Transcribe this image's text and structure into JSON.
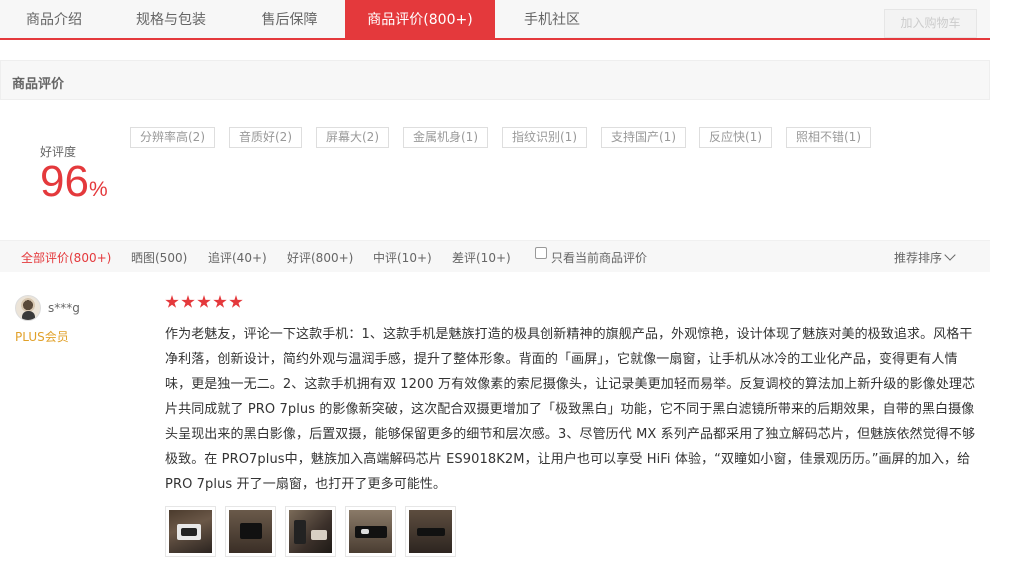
{
  "tabs": [
    {
      "label": "商品介绍"
    },
    {
      "label": "规格与包装"
    },
    {
      "label": "售后保障"
    },
    {
      "label": "商品评价(800+)",
      "active": true
    },
    {
      "label": "手机社区"
    }
  ],
  "cart_button": "加入购物车",
  "section_title": "商品评价",
  "rating": {
    "label": "好评度",
    "value": "96",
    "unit": "%"
  },
  "tags": [
    "分辨率高(2)",
    "音质好(2)",
    "屏幕大(2)",
    "金属机身(1)",
    "指纹识别(1)",
    "支持国产(1)",
    "反应快(1)",
    "照相不错(1)"
  ],
  "filters": [
    {
      "label": "全部评价(800+)",
      "active": true
    },
    {
      "label": "晒图(500)"
    },
    {
      "label": "追评(40+)"
    },
    {
      "label": "好评(800+)"
    },
    {
      "label": "中评(10+)"
    },
    {
      "label": "差评(10+)"
    }
  ],
  "only_current_label": "只看当前商品评价",
  "sort_label": "推荐排序",
  "review": {
    "username": "s***g",
    "member_label": "PLUS会员",
    "stars": 5,
    "text": "作为老魅友，评论一下这款手机：1、这款手机是魅族打造的极具创新精神的旗舰产品，外观惊艳，设计体现了魅族对美的极致追求。风格干净利落，创新设计，简约外观与温润手感，提升了整体形象。背面的「画屏」，它就像一扇窗，让手机从冰冷的工业化产品，变得更有人情味，更是独一无二。2、这款手机拥有双 1200 万有效像素的索尼摄像头，让记录美更加轻而易举。反复调校的算法加上新升级的影像处理芯片共同成就了 PRO 7plus 的影像新突破，这次配合双摄更增加了「极致黑白」功能，它不同于黑白滤镜所带来的后期效果，自带的黑白摄像头呈现出来的黑白影像，后置双摄，能够保留更多的细节和层次感。3、尽管历代 MX 系列产品都采用了独立解码芯片，但魅族依然觉得不够极致。在 PRO7plus中，魅族加入高端解码芯片 ES9018K2M，让用户也可以享受 HiFi 体验，“双瞳如小窗，佳景观历历。”画屏的加入，给 PRO 7plus 开了一扇窗，也打开了更多可能性。",
    "image_count": 5
  },
  "colors": {
    "accent": "#e4393c",
    "member": "#e1a12a"
  }
}
